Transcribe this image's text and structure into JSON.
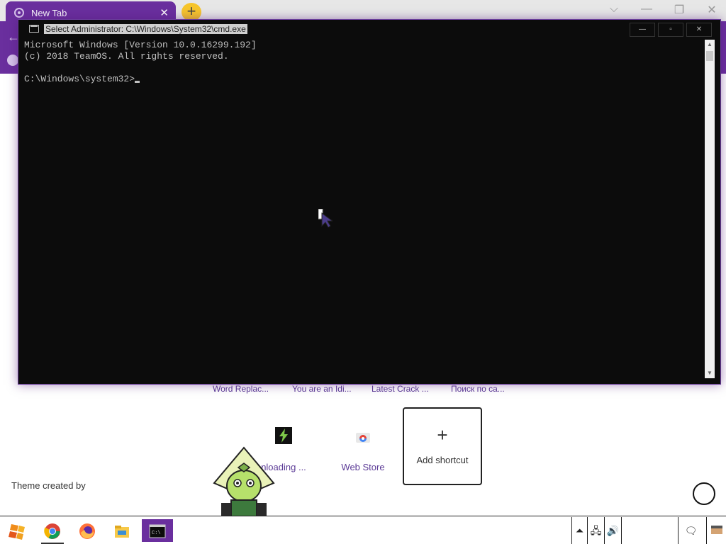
{
  "browser": {
    "tab_title": "New Tab",
    "tab_close": "✕",
    "new_tab": "+",
    "window_controls": [
      "⌵",
      "—",
      "❐",
      "✕"
    ]
  },
  "shortcut_links": [
    "Word Replac...",
    "You are an Idi...",
    "Latest Crack ...",
    "Поиск по са..."
  ],
  "tiles": {
    "downloading_label": "nloading ...",
    "store_label": "Web Store",
    "add_plus": "+",
    "add_label": "Add shortcut"
  },
  "theme_credit": "Theme created by",
  "cmd": {
    "title": "Select Administrator: C:\\Windows\\System32\\cmd.exe",
    "buttons": [
      "—",
      "▫",
      "✕"
    ],
    "lines": [
      "Microsoft Windows [Version 10.0.16299.192]",
      "(c) 2018 TeamOS. All rights reserved.",
      "",
      "C:\\Windows\\system32>"
    ],
    "scroll_up": "▲",
    "scroll_down": "▼"
  },
  "taskbar": {
    "apps": [
      "start-icon",
      "chrome-icon",
      "firefox-icon",
      "file-explorer-icon",
      "cmd-icon"
    ],
    "tray_overflow": "⏶",
    "tray_network": "🖧",
    "tray_volume": "🔊",
    "tray_notifications": "🗨"
  },
  "colors": {
    "theme_purple": "#6a2f9e",
    "link_purple": "#5b3a96",
    "cmd_background": "#0c0c0c",
    "cmd_text": "#c0c0c0",
    "new_tab_yellow": "#f7c52b"
  }
}
